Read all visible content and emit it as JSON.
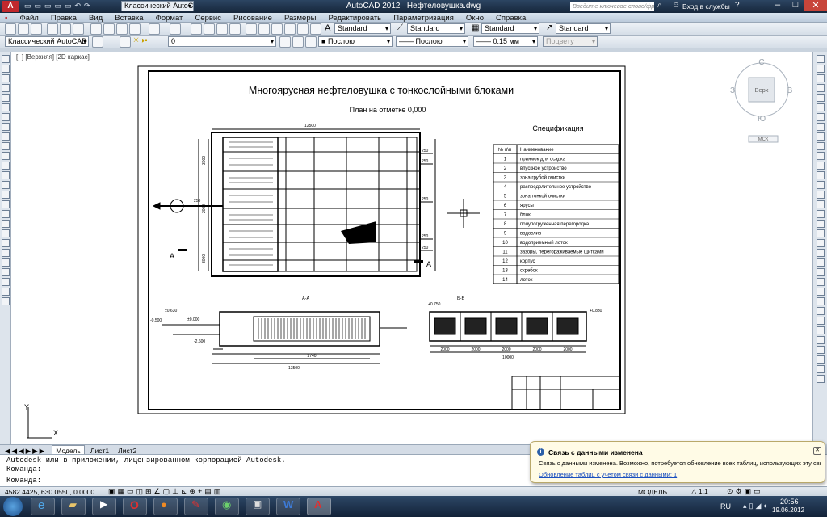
{
  "app": {
    "title": "AutoCAD 2012",
    "file": "Нефтеловушка.dwg",
    "workspace": "Классический AutoCAD",
    "search_placeholder": "Введите ключевое слово/фразу",
    "login": "Вход в службы"
  },
  "menu": [
    "Файл",
    "Правка",
    "Вид",
    "Вставка",
    "Формат",
    "Сервис",
    "Рисование",
    "Размеры",
    "Редактировать",
    "Параметризация",
    "Окно",
    "Справка"
  ],
  "styles": {
    "text": "Standard",
    "dim": "Standard",
    "table": "Standard",
    "mleader": "Standard"
  },
  "props": {
    "workspace2": "Классический AutoCAD",
    "layer": "0",
    "color": "Послою",
    "linetype": "Послою",
    "lineweight": "0.15 мм",
    "plotstyle": "Поцвету"
  },
  "viewport_label": "[−] [Верхняя] [2D каркас]",
  "viewcube": {
    "n": "С",
    "s": "Ю",
    "w": "З",
    "e": "В",
    "top": "Верх",
    "wcs": "МСК"
  },
  "drawing": {
    "title": "Многоярусная нефтеловушка с тонкослойными блоками",
    "plan_title": "План на отметке 0,000",
    "spec_title": "Спецификация",
    "spec_header": [
      "№ п\\п",
      "Наименование"
    ],
    "spec": [
      [
        "1",
        "приямок для осадка"
      ],
      [
        "2",
        "впускное устройство"
      ],
      [
        "3",
        "зона грубой очистки"
      ],
      [
        "4",
        "распределительное устройство"
      ],
      [
        "5",
        "зона тонкой очистки"
      ],
      [
        "6",
        "ярусы"
      ],
      [
        "7",
        "блок"
      ],
      [
        "8",
        "полупогруженная перегородка"
      ],
      [
        "9",
        "водослив"
      ],
      [
        "10",
        "водоприемный лоток"
      ],
      [
        "11",
        "зазоры, перегораживаемые щитками"
      ],
      [
        "12",
        "корпус"
      ],
      [
        "13",
        "скребок"
      ],
      [
        "14",
        "лоток"
      ]
    ],
    "section_aa": "А-А",
    "section_bb": "Б-Б",
    "dim_top": "12500",
    "dim_bottom": "13500",
    "dim_inner": "2740",
    "dim_bb_total": "10000",
    "dim_bb_parts": [
      "2000",
      "2000",
      "2000",
      "2000",
      "2000"
    ],
    "level_labels": [
      "±0.000",
      "-0.500",
      "±0.630",
      "+0.750",
      "+0.830",
      "-2.600"
    ],
    "side_dims": [
      "3000",
      "3000",
      "2000"
    ],
    "pipe_dims": [
      "250",
      "250",
      "250",
      "250",
      "250",
      "250"
    ],
    "arrow_a": "А"
  },
  "axis": {
    "y": "Y",
    "x": "X"
  },
  "tabs": [
    "Модель",
    "Лист1",
    "Лист2"
  ],
  "cmd": {
    "line1": "Autodesk или в приложении, лицензированном корпорацией Autodesk.",
    "line2": "Команда:",
    "prompt": "Команда:"
  },
  "status": {
    "coords": "4582.4425, 630.0550, 0.0000",
    "model": "МОДЕЛЬ",
    "scale": "1:1"
  },
  "notification": {
    "title": "Связь с данными изменена",
    "body": "Связь с данными изменена. Возможно, потребуется обновление всех таблиц, использующих эту связь.",
    "link": "Обновление таблиц с учетом связи с данными: 1"
  },
  "taskbar": {
    "lang": "RU",
    "time": "20:56",
    "date": "19.06.2012"
  },
  "colors": {
    "titlebar": "#1c2f45",
    "canvas": "#ffffff",
    "taskbar": "#1a2a40",
    "accent": "#2b5fa8"
  }
}
